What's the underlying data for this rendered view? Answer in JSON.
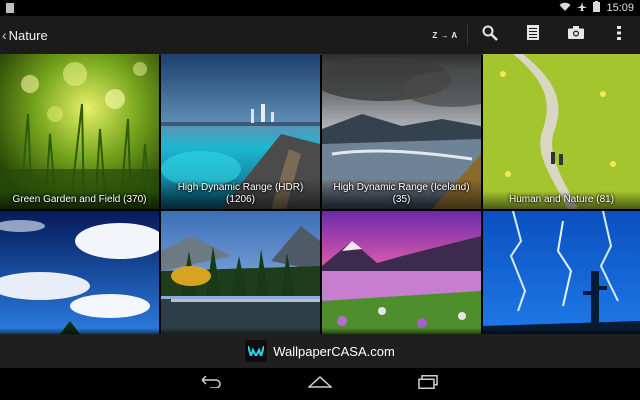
{
  "status_bar": {
    "time": "15:09"
  },
  "header": {
    "title": "Nature",
    "sort_label": "Z → A"
  },
  "tiles": [
    {
      "caption": "Green Garden and Field (370)"
    },
    {
      "caption": "High Dynamic Range (HDR) (1206)"
    },
    {
      "caption": "High Dynamic Range (Iceland) (35)"
    },
    {
      "caption": "Human and Nature (81)"
    },
    {
      "caption": ""
    },
    {
      "caption": ""
    },
    {
      "caption": ""
    },
    {
      "caption": ""
    }
  ],
  "banner": {
    "brand": "WallpaperCASA.com"
  }
}
